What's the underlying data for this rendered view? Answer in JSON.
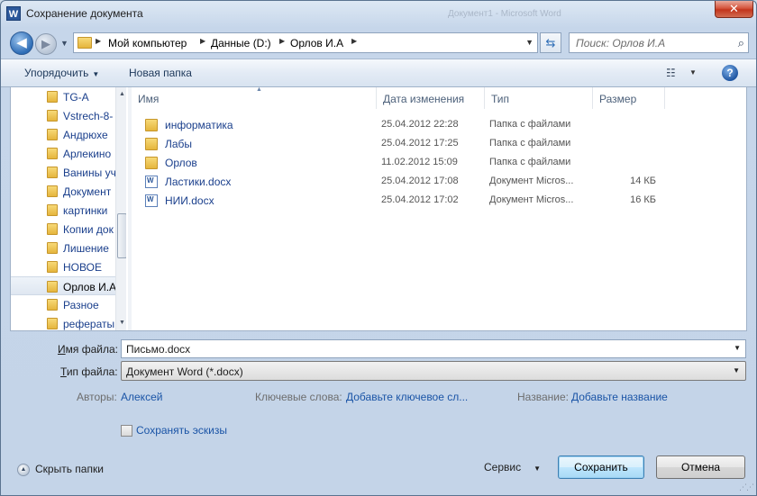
{
  "window": {
    "title": "Сохранение документа",
    "app_icon_letter": "W",
    "close_label": "✕",
    "ghost_title": "Документ1 - Microsoft Word"
  },
  "address": {
    "segments": [
      "Мой компьютер",
      "Данные (D:)",
      "Орлов И.А"
    ],
    "search_placeholder": "Поиск: Орлов И.А"
  },
  "toolbar": {
    "organize_label": "Упорядочить",
    "new_folder_label": "Новая папка",
    "help_label": "?"
  },
  "nav": {
    "items": [
      {
        "label": "TG-A"
      },
      {
        "label": "Vstrech-8-"
      },
      {
        "label": "Андрюхе"
      },
      {
        "label": "Арлекино"
      },
      {
        "label": "Ванины уч"
      },
      {
        "label": "Документ"
      },
      {
        "label": "картинки"
      },
      {
        "label": "Копии док"
      },
      {
        "label": "Лишение"
      },
      {
        "label": "НОВОЕ"
      },
      {
        "label": "Орлов И.А"
      },
      {
        "label": "Разное"
      },
      {
        "label": "рефераты"
      }
    ],
    "selected_index": 10
  },
  "columns": {
    "name": "Имя",
    "date": "Дата изменения",
    "type": "Тип",
    "size": "Размер"
  },
  "files": [
    {
      "name": "информатика",
      "date": "25.04.2012 22:28",
      "type": "Папка с файлами",
      "size": "",
      "kind": "folder"
    },
    {
      "name": "Лабы",
      "date": "25.04.2012 17:25",
      "type": "Папка с файлами",
      "size": "",
      "kind": "folder"
    },
    {
      "name": "Орлов",
      "date": "11.02.2012 15:09",
      "type": "Папка с файлами",
      "size": "",
      "kind": "folder"
    },
    {
      "name": "Ластики.docx",
      "date": "25.04.2012 17:08",
      "type": "Документ Micros...",
      "size": "14 КБ",
      "kind": "doc"
    },
    {
      "name": "НИИ.docx",
      "date": "25.04.2012 17:02",
      "type": "Документ Micros...",
      "size": "16 КБ",
      "kind": "doc"
    }
  ],
  "form": {
    "filename_label_pre": "И",
    "filename_label_rest": "мя файла:",
    "filename_value": "Письмо.docx",
    "filetype_label_pre": "Т",
    "filetype_label_rest": "ип файла:",
    "filetype_value": "Документ Word (*.docx)",
    "authors_label": "Авторы:",
    "authors_value": "Алексей",
    "keywords_label": "Ключевые слова:",
    "keywords_value": "Добавьте ключевое сл...",
    "title_label": "Название:",
    "title_value": "Добавьте название",
    "thumbnails_label": "Сохранять эскизы"
  },
  "footer": {
    "hide_folders_label": "Скрыть папки",
    "service_label": "Сервис",
    "save_label": "Сохранить",
    "cancel_label": "Отмена"
  }
}
